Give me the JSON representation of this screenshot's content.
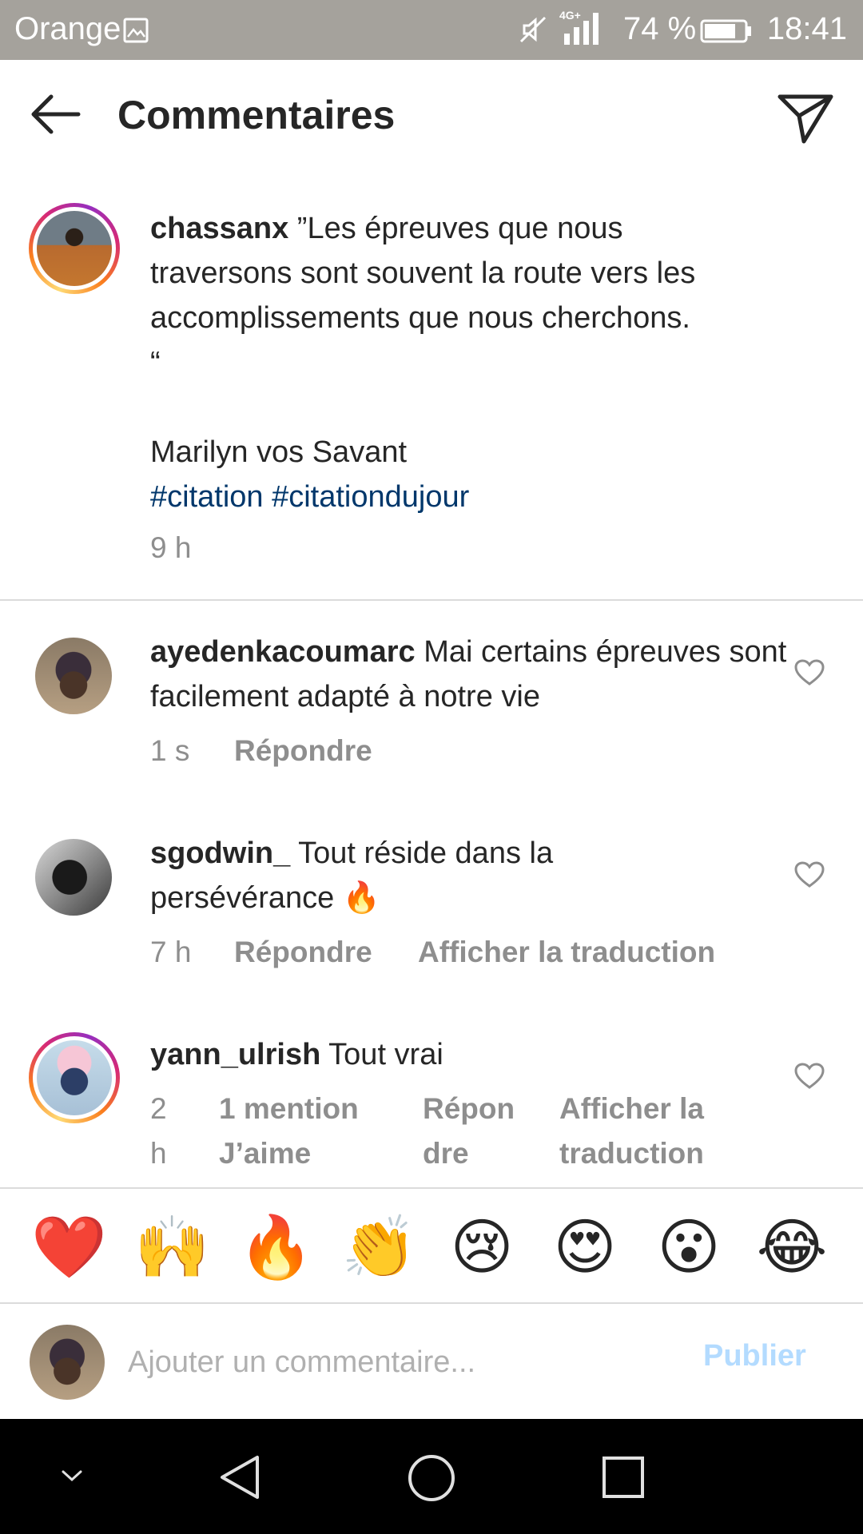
{
  "status_bar": {
    "carrier": "Orange",
    "network": "4G+",
    "battery": "74 %",
    "time": "18:41",
    "icons": [
      "gallery-icon",
      "mute-icon",
      "signal-icon",
      "battery-icon"
    ]
  },
  "header": {
    "title": "Commentaires",
    "back_icon": "arrow-left-icon",
    "send_icon": "paper-plane-icon"
  },
  "caption": {
    "username": "chassanx",
    "lines": [
      "”Les épreuves que nous",
      "traversons sont souvent la route vers les",
      "accomplissements que nous cherchons.",
      "“",
      "",
      "Marilyn vos Savant"
    ],
    "hashtags": [
      "#citation",
      "#citationdujour"
    ],
    "time": "9 h"
  },
  "comments": [
    {
      "username": "ayedenkacoumarc",
      "text": "Mai certains épreuves sont facilement adapté à notre vie",
      "time": "1 s",
      "reply": "Répondre"
    },
    {
      "username": "sgodwin_",
      "text": "Tout réside dans la persévérance 🔥",
      "time": "7 h",
      "reply": "Répondre",
      "translate": "Afficher la traduction"
    },
    {
      "username": "yann_ulrish",
      "text": "Tout vrai",
      "time_lines": [
        "2",
        "h"
      ],
      "likes_lines": [
        "1 mention",
        "J’aime"
      ],
      "reply_lines": [
        "Répon",
        "dre"
      ],
      "translate_lines": [
        "Afficher la",
        "traduction"
      ]
    }
  ],
  "emoji_bar": [
    "❤️",
    "🙌",
    "🔥",
    "👏",
    "😢",
    "😍",
    "😮",
    "😂"
  ],
  "composer": {
    "placeholder": "Ajouter un commentaire...",
    "publish": "Publier"
  },
  "colors": {
    "status_bar": "#a5a29c",
    "hashtag": "#00376b",
    "muted_text": "#8e8e8e",
    "publish_disabled": "#b3dbff"
  }
}
